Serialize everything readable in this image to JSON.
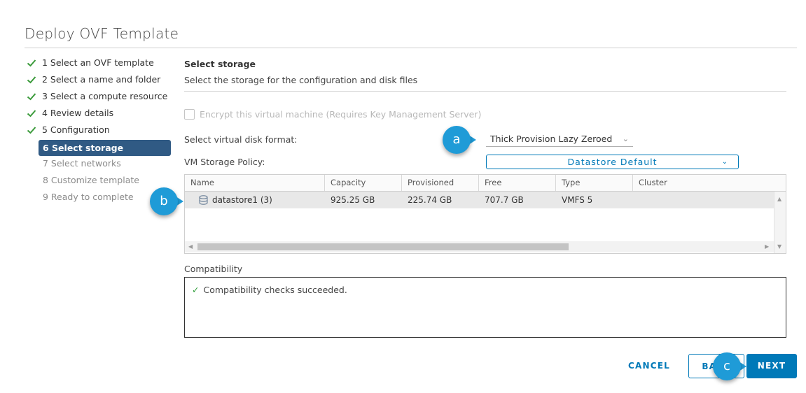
{
  "dialog": {
    "title": "Deploy OVF Template"
  },
  "steps": [
    {
      "label": "1 Select an OVF template",
      "state": "done"
    },
    {
      "label": "2 Select a name and folder",
      "state": "done"
    },
    {
      "label": "3 Select a compute resource",
      "state": "done"
    },
    {
      "label": "4 Review details",
      "state": "done"
    },
    {
      "label": "5 Configuration",
      "state": "done"
    },
    {
      "label": "6 Select storage",
      "state": "active"
    },
    {
      "label": "7 Select networks",
      "state": "pending"
    },
    {
      "label": "8 Customize template",
      "state": "pending"
    },
    {
      "label": "9 Ready to complete",
      "state": "pending"
    }
  ],
  "section": {
    "title": "Select storage",
    "subtitle": "Select the storage for the configuration and disk files"
  },
  "encrypt": {
    "label": "Encrypt this virtual machine (Requires Key Management Server)",
    "checked": false,
    "disabled": true
  },
  "disk_format": {
    "label": "Select virtual disk format:",
    "value": "Thick Provision Lazy Zeroed"
  },
  "storage_policy": {
    "label": "VM Storage Policy:",
    "value": "Datastore Default"
  },
  "grid": {
    "columns": [
      "Name",
      "Capacity",
      "Provisioned",
      "Free",
      "Type",
      "Cluster"
    ],
    "rows": [
      {
        "name": "datastore1 (3)",
        "capacity": "925.25 GB",
        "provisioned": "225.74 GB",
        "free": "707.7 GB",
        "type": "VMFS 5",
        "cluster": ""
      }
    ]
  },
  "compatibility": {
    "label": "Compatibility",
    "message": "Compatibility checks succeeded."
  },
  "buttons": {
    "cancel": "CANCEL",
    "back": "BACK",
    "next": "NEXT"
  },
  "callouts": {
    "a": "a",
    "b": "b",
    "c": "c"
  },
  "colors": {
    "accent": "#0079b8",
    "active_step": "#305a84",
    "callout": "#1f9bd7",
    "success": "#2f9e3a"
  },
  "icons": {
    "done_step": "checkmark-icon",
    "datastore": "database-icon",
    "dropdown": "chevron-down-icon"
  }
}
